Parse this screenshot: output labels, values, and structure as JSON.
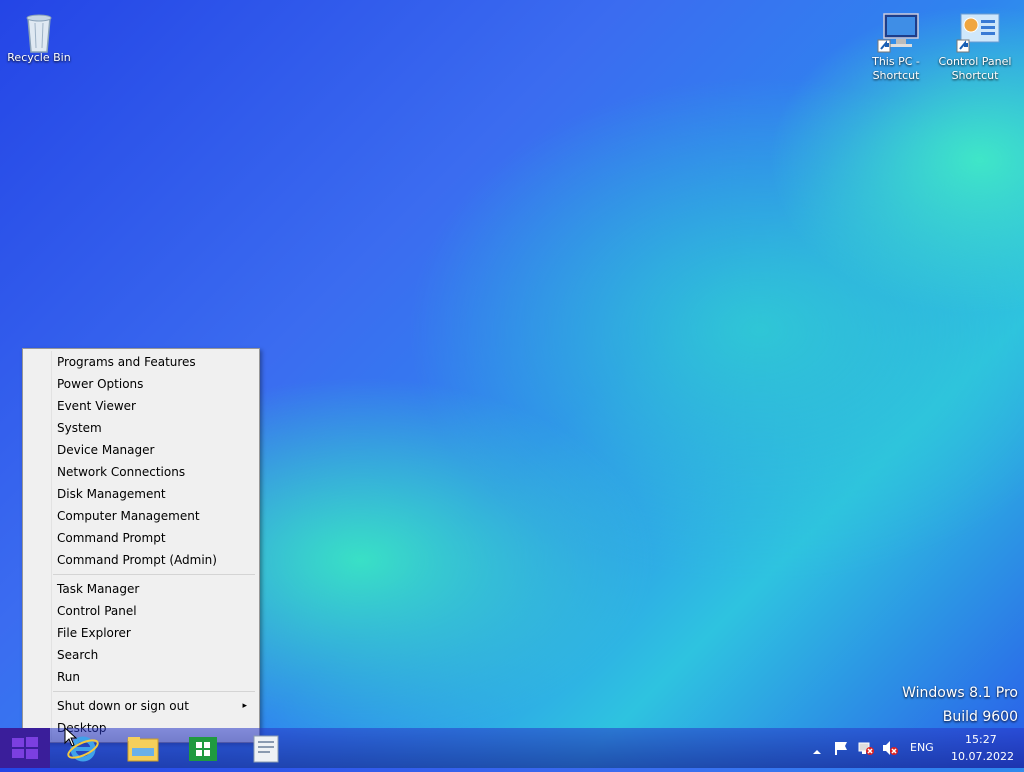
{
  "desktop": {
    "icons": [
      {
        "label": "Recycle Bin"
      },
      {
        "label": "This PC - Shortcut"
      },
      {
        "label": "Control Panel Shortcut"
      }
    ]
  },
  "context_menu": {
    "items_group1": [
      "Programs and Features",
      "Power Options",
      "Event Viewer",
      "System",
      "Device Manager",
      "Network Connections",
      "Disk Management",
      "Computer Management",
      "Command Prompt",
      "Command Prompt (Admin)"
    ],
    "items_group2": [
      "Task Manager",
      "Control Panel",
      "File Explorer",
      "Search",
      "Run"
    ],
    "items_group3": [
      "Shut down or sign out",
      "Desktop"
    ],
    "submenu_arrow": "▸"
  },
  "watermark": {
    "line1": "Windows 8.1 Pro",
    "line2": "Build 9600"
  },
  "taskbar": {
    "pinned": [
      "start-button",
      "internet-explorer-icon",
      "file-explorer-icon",
      "store-icon",
      "document-icon"
    ],
    "tray": {
      "language": "ENG",
      "time": "15:27",
      "date": "10.07.2022"
    }
  },
  "colors": {
    "menu_bg": "#f0f0f0",
    "taskbar": "#2838c8",
    "start_purple": "#6a2ab8"
  }
}
